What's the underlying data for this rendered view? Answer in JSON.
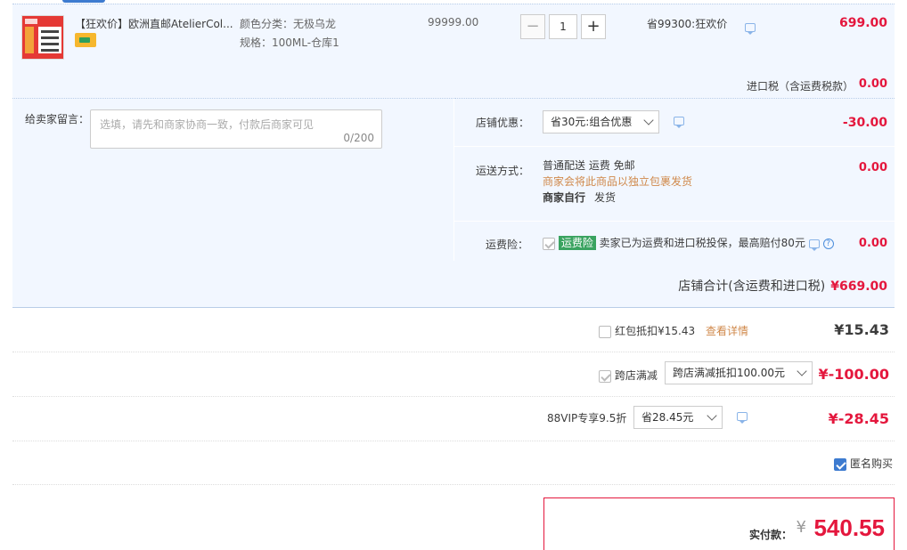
{
  "item": {
    "title": "【狂欢价】欧洲直邮AtelierCol...",
    "sku_color": "颜色分类：无极乌龙",
    "sku_spec": "规格：100ML-仓库1",
    "unit_price": "99999.00",
    "minus": "−",
    "quantity": "1",
    "plus": "+",
    "save_text": "省99300:狂欢价",
    "total": "699.00",
    "tax_label": "进口税（含运费税款）",
    "tax_value": "0.00"
  },
  "message": {
    "label": "给卖家留言：",
    "placeholder": "选填，请先和商家协商一致，付款后商家可见",
    "count": "0/200"
  },
  "shop_discount": {
    "label": "店铺优惠：",
    "selected": "省30元:组合优惠",
    "amount": "-30.00"
  },
  "shipping": {
    "label": "运送方式：",
    "method": "普通配送 运费 免邮",
    "note": "商家会将此商品以独立包裹发货",
    "self_label": "商家自行",
    "self_value": "发货",
    "amount": "0.00"
  },
  "insurance": {
    "label": "运费险：",
    "tag": "运费险",
    "desc": "卖家已为运费和进口税投保，最高赔付80元",
    "help": "?",
    "amount": "0.00"
  },
  "shop_total": {
    "label": "店铺合计(含运费和进口税)",
    "value": "¥669.00"
  },
  "red_packet": {
    "label": "红包抵扣¥15.43",
    "link": "查看详情",
    "value": "¥15.43"
  },
  "cross_store": {
    "label": "跨店满减",
    "selected": "跨店满减抵扣100.00元",
    "value": "¥-100.00"
  },
  "vip": {
    "label": "88VIP专享9.5折",
    "selected": "省28.45元",
    "value": "¥-28.45"
  },
  "anonymous": {
    "label": "匿名购买"
  },
  "payment": {
    "label": "实付款：",
    "currency": "¥",
    "value": "540.55"
  },
  "colors": {
    "accent_red": "#e4173d",
    "accent_blue": "#3d7bd0",
    "panel_bg": "#f2f7ff",
    "orange_text": "#d0894b",
    "insurance_green": "#3aa360"
  }
}
